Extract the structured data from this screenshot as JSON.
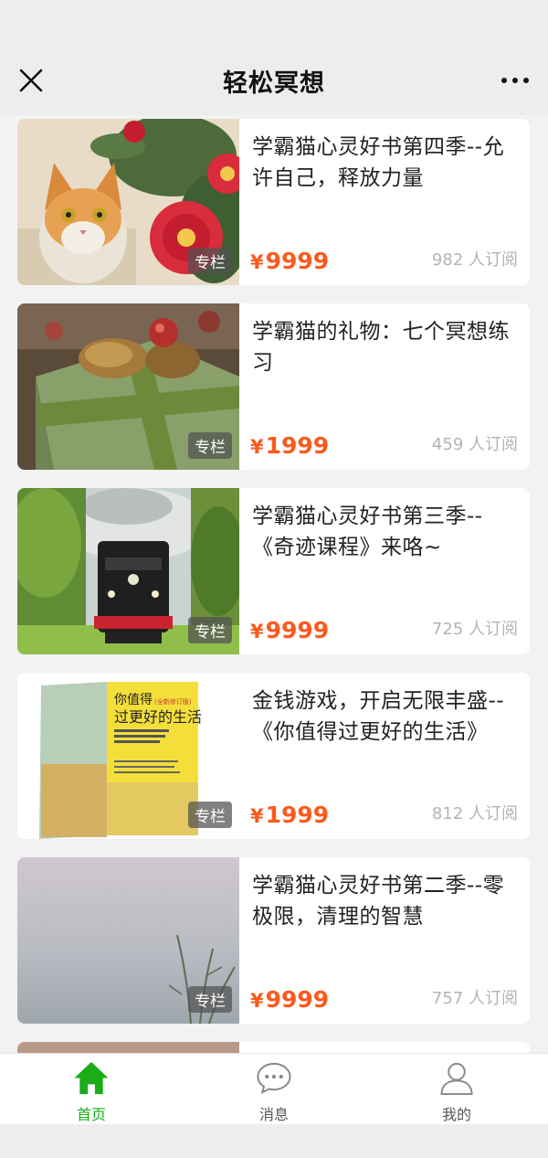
{
  "header": {
    "title": "轻松冥想",
    "close_icon": "close-icon",
    "more_icon": "more-icon"
  },
  "courses": [
    {
      "title": "学霸猫心灵好书第四季--允许自己，释放力量",
      "tag": "专栏",
      "currency": "¥",
      "price": "9999",
      "subscribers": "982 人订阅",
      "thumb": "cat-camellia-painting"
    },
    {
      "title": "学霸猫的礼物：七个冥想练习",
      "tag": "专栏",
      "currency": "¥",
      "price": "1999",
      "subscribers": "459 人订阅",
      "thumb": "gift-box-pinecones"
    },
    {
      "title": "学霸猫心灵好书第三季--《奇迹课程》来咯~",
      "tag": "专栏",
      "currency": "¥",
      "price": "9999",
      "subscribers": "725 人订阅",
      "thumb": "steam-train-forest"
    },
    {
      "title": "金钱游戏，开启无限丰盛--《你值得过更好的生活》",
      "tag": "专栏",
      "currency": "¥",
      "price": "1999",
      "subscribers": "812 人订阅",
      "thumb": "book-cover",
      "book_cover": {
        "title_line1": "你值得",
        "badge": "(全新修订版)",
        "title_line2": "过更好的生活"
      }
    },
    {
      "title": "学霸猫心灵好书第二季--零极限，清理的智慧",
      "tag": "专栏",
      "currency": "¥",
      "price": "9999",
      "subscribers": "757 人订阅",
      "thumb": "misty-grass"
    }
  ],
  "tabbar": {
    "items": [
      {
        "label": "首页",
        "icon": "home-icon",
        "active": true
      },
      {
        "label": "消息",
        "icon": "chat-icon",
        "active": false
      },
      {
        "label": "我的",
        "icon": "user-icon",
        "active": false
      }
    ]
  },
  "colors": {
    "accent": "#1aad19",
    "price": "#fa5a1e"
  }
}
